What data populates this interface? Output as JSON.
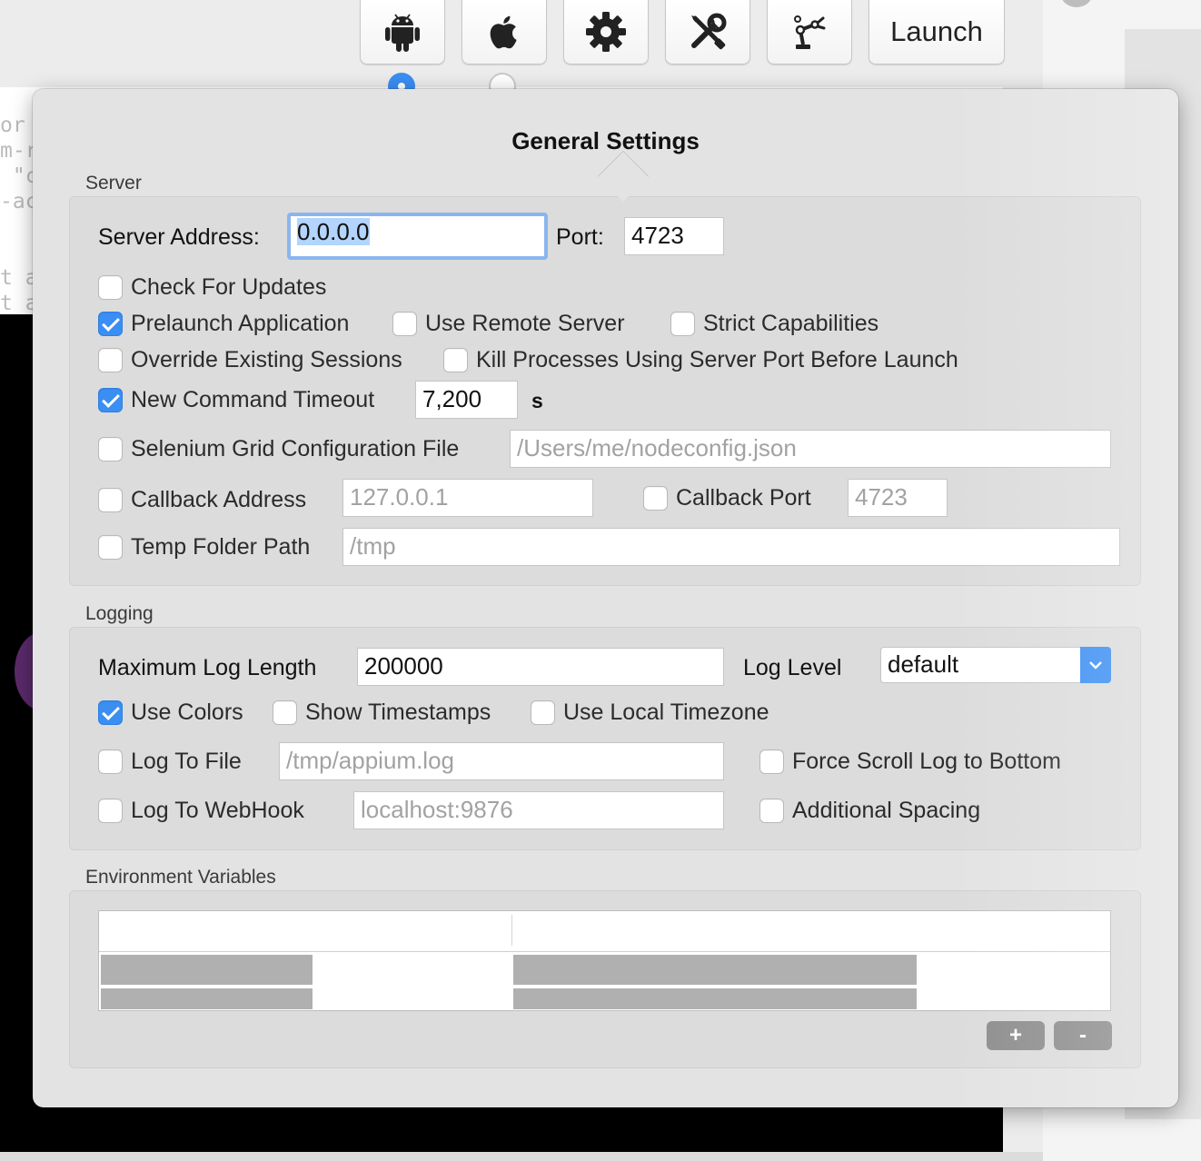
{
  "toolbar": {
    "buttons": [
      {
        "icon": "android-icon"
      },
      {
        "icon": "apple-icon"
      },
      {
        "icon": "gear-icon"
      },
      {
        "icon": "tools-icon"
      },
      {
        "icon": "robot-arm-icon"
      }
    ],
    "launch_label": "Launch"
  },
  "background_terminal": {
    "lines": [
      "or",
      "m-r",
      " \"c",
      "-ac",
      "",
      "",
      "t a",
      "t a"
    ]
  },
  "popover": {
    "title": "General Settings",
    "server": {
      "section_label": "Server",
      "server_address_label": "Server Address:",
      "server_address_value": "0.0.0.0",
      "port_label": "Port:",
      "port_value": "4723",
      "check_for_updates": {
        "label": "Check For Updates",
        "checked": false
      },
      "prelaunch_application": {
        "label": "Prelaunch Application",
        "checked": true
      },
      "use_remote_server": {
        "label": "Use Remote Server",
        "checked": false
      },
      "strict_capabilities": {
        "label": "Strict Capabilities",
        "checked": false
      },
      "override_existing_sessions": {
        "label": "Override Existing Sessions",
        "checked": false
      },
      "kill_processes": {
        "label": "Kill Processes Using Server Port Before Launch",
        "checked": false
      },
      "new_command_timeout": {
        "label": "New Command Timeout",
        "checked": true,
        "value": "7,200",
        "unit": "s"
      },
      "selenium_grid": {
        "label": "Selenium Grid Configuration File",
        "checked": false,
        "placeholder": "/Users/me/nodeconfig.json"
      },
      "callback_address": {
        "label": "Callback Address",
        "checked": false,
        "placeholder": "127.0.0.1"
      },
      "callback_port": {
        "label": "Callback Port",
        "checked": false,
        "placeholder": "4723"
      },
      "temp_folder_path": {
        "label": "Temp Folder Path",
        "checked": false,
        "placeholder": "/tmp"
      }
    },
    "logging": {
      "section_label": "Logging",
      "max_log_length_label": "Maximum Log Length",
      "max_log_length_value": "200000",
      "log_level_label": "Log Level",
      "log_level_value": "default",
      "use_colors": {
        "label": "Use Colors",
        "checked": true
      },
      "show_timestamps": {
        "label": "Show Timestamps",
        "checked": false
      },
      "use_local_timezone": {
        "label": "Use Local Timezone",
        "checked": false
      },
      "log_to_file": {
        "label": "Log To File",
        "checked": false,
        "placeholder": "/tmp/appium.log"
      },
      "force_scroll": {
        "label": "Force Scroll Log to Bottom",
        "checked": false
      },
      "log_to_webhook": {
        "label": "Log To WebHook",
        "checked": false,
        "placeholder": "localhost:9876"
      },
      "additional_spacing": {
        "label": "Additional Spacing",
        "checked": false
      }
    },
    "env": {
      "section_label": "Environment Variables",
      "add_label": "+",
      "remove_label": "-"
    }
  },
  "colors": {
    "accent": "#3b8ef2",
    "panel": "#e3e3e3",
    "group": "#dcdcdc"
  }
}
